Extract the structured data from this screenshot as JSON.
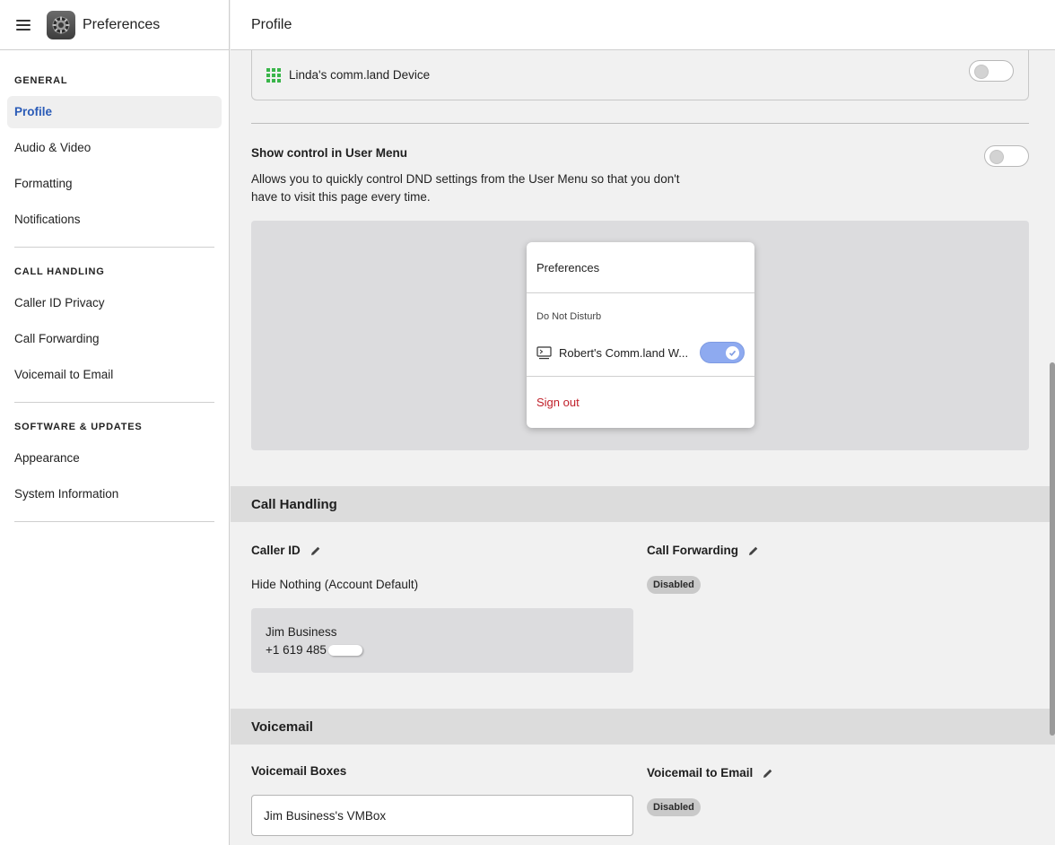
{
  "app": {
    "title": "Preferences",
    "menu_icon": "hamburger-icon",
    "app_icon": "gear-icon"
  },
  "sidebar": {
    "sections": [
      {
        "title": "GENERAL",
        "items": [
          "Profile",
          "Audio & Video",
          "Formatting",
          "Notifications"
        ]
      },
      {
        "title": "CALL HANDLING",
        "items": [
          "Caller ID Privacy",
          "Call Forwarding",
          "Voicemail to Email"
        ]
      },
      {
        "title": "SOFTWARE & UPDATES",
        "items": [
          "Appearance",
          "System Information"
        ]
      }
    ],
    "active_item": "Profile"
  },
  "main": {
    "header_title": "Profile",
    "device": {
      "name": "Linda's comm.land Device",
      "icon": "grid-icon",
      "toggle_on": false
    },
    "show_control": {
      "title": "Show control in User Menu",
      "description": "Allows you to quickly control DND settings from the User Menu so that you don't have to visit this page every time.",
      "toggle_on": false
    },
    "preview_menu": {
      "title": "Preferences",
      "dnd_label": "Do Not Disturb",
      "device_label": "Robert's Comm.land W...",
      "device_icon": "monitor-icon",
      "device_toggle_on": true,
      "sign_out": "Sign out"
    },
    "call_handling": {
      "section_title": "Call Handling",
      "caller_id": {
        "label": "Caller ID",
        "value": "Hide Nothing (Account Default)",
        "card_name": "Jim Business",
        "card_number": "+1 619 485"
      },
      "call_forwarding": {
        "label": "Call Forwarding",
        "status": "Disabled"
      }
    },
    "voicemail": {
      "section_title": "Voicemail",
      "boxes": {
        "label": "Voicemail Boxes",
        "value": "Jim Business's VMBox"
      },
      "to_email": {
        "label": "Voicemail to Email",
        "status": "Disabled"
      }
    }
  },
  "colors": {
    "accent": "#2a5bb7",
    "sign_out": "#c0202a",
    "toggle_on": "#8eaaf0",
    "device_icon": "#39b54a"
  }
}
